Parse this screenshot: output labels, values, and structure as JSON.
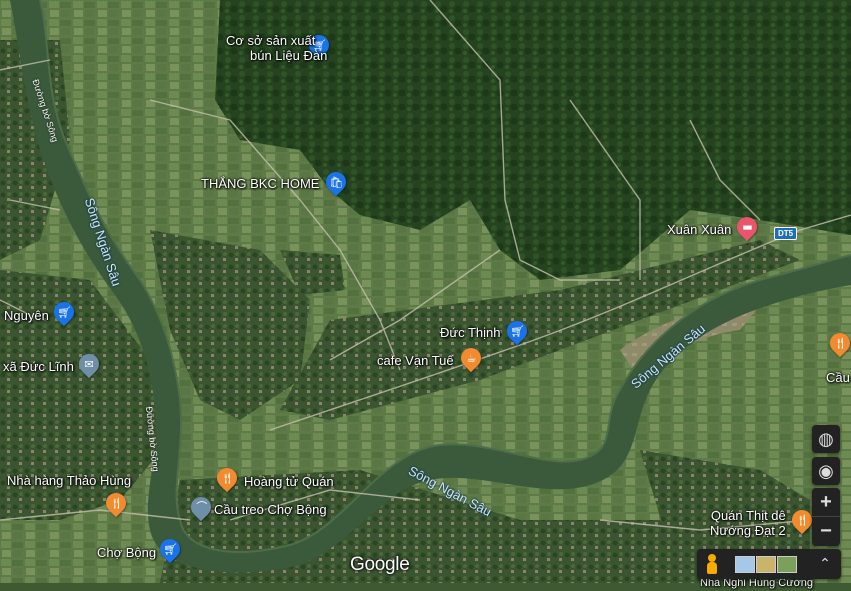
{
  "map": {
    "labels": {
      "co_so_line1": "Cơ sở sản xuất",
      "co_so_line2": "bún Liệu Đàn",
      "thang_bkc": "THẮNG BKC HOME",
      "xuan_xuan": "Xuân Xuân",
      "duc_thinh": "Đức Thịnh",
      "cafe": "cafe Vạn Tuế",
      "nguyen": "Nguyên",
      "xa_duc_linh": "xã Đức Lĩnh",
      "nha_hang": "Nhà hàng Thảo Hùng",
      "hoang_tu": "Hoàng tử Quán",
      "cau_treo": "Cầu treo Chợ Bộng",
      "cho_bong": "Chợ Bộng",
      "quan_thit_line1": "Quán Thịt dê",
      "quan_thit_line2": "Nướng Đạt 2",
      "cau": "Cầu",
      "bottom_cut": "Nhà Nghỉ Hùng Cường"
    },
    "rivers": {
      "song_ngan_sau_1": "Sông Ngàn Sâu",
      "song_ngan_sau_2": "Sông Ngàn Sâu",
      "song_ngan_sau_3": "Sông Ngàn Sâu"
    },
    "roads": {
      "duong_bo_song_1": "Đường bờ Sông",
      "duong_bo_song_2": "Đường bờ Sông",
      "dt5": "DT5"
    },
    "icons": {
      "shopping": "shopping-cart-icon",
      "restaurant": "fork-knife-icon",
      "cafe": "coffee-cup-icon",
      "government": "envelope-icon",
      "bridge": "bridge-icon",
      "hotel": "bed-icon"
    },
    "colors": {
      "shopping_pin": "#1a73e8",
      "food_pin": "#f28b30",
      "lodging_pin": "#e8556c",
      "river": "#3b5a3c",
      "road": "#c8c2b0"
    },
    "logo": "Google"
  },
  "controls": {
    "globe": "globe-icon",
    "locate": "my-location-icon",
    "zoom_in": "+",
    "zoom_out": "−",
    "pegman": "pegman-icon",
    "expand": "expand-icon"
  }
}
